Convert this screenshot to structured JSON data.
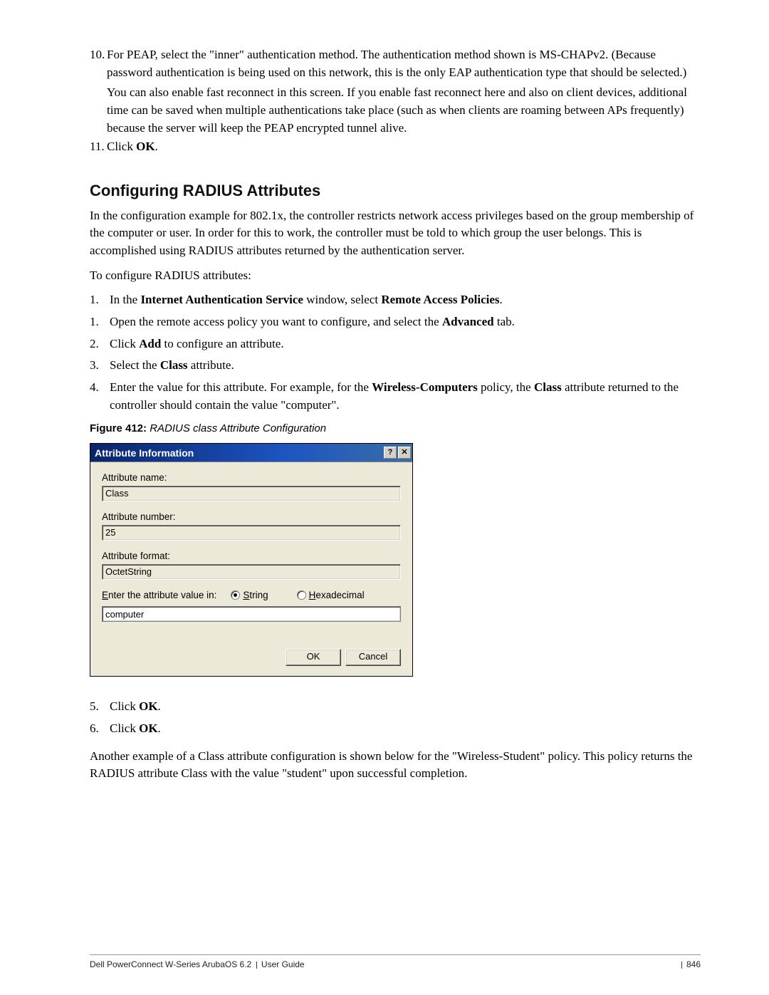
{
  "step10": {
    "num": "10.",
    "p1": "For PEAP, select the \"inner\" authentication method. The authentication method shown is MS-CHAPv2. (Because password authentication is being used on this network, this is the only EAP authentication type that should be selected.)",
    "p2": "You can also enable fast reconnect in this screen. If you enable fast reconnect here and also on client devices, additional time can be saved when multiple authentications take place (such as when clients are roaming between APs frequently) because the server will keep the PEAP encrypted tunnel alive."
  },
  "step11": {
    "num": "11.",
    "prefix": "Click ",
    "bold": "OK",
    "suffix": "."
  },
  "heading": "Configuring RADIUS Attributes",
  "intro": "In the configuration example for 802.1x, the controller restricts network access privileges based on the group membership of the computer or user. In order for this to work, the controller must be told to which group the user belongs. This is accomplished using RADIUS attributes returned by the authentication server.",
  "lead": "To configure RADIUS attributes:",
  "config": {
    "i1": {
      "n": "1.",
      "a": "In the ",
      "b": "Internet Authentication Service",
      "c": " window, select ",
      "d": "Remote Access Policies",
      "e": "."
    },
    "i2": {
      "n": "1.",
      "a": "Open the remote access policy you want to configure, and select the ",
      "b": "Advanced",
      "c": " tab."
    },
    "i3": {
      "n": "2.",
      "a": "Click ",
      "b": "Add",
      "c": " to configure an attribute."
    },
    "i4": {
      "n": "3.",
      "a": "Select the ",
      "b": "Class",
      "c": " attribute."
    },
    "i5": {
      "n": "4.",
      "a": "Enter the value for this attribute. For example, for the ",
      "b": "Wireless-Computers",
      "c": " policy, the ",
      "d": "Class",
      "e": " attribute returned to the controller should contain the value \"computer\"."
    }
  },
  "figure": {
    "label": "Figure 412:",
    "caption": " RADIUS class Attribute Configuration"
  },
  "dialog": {
    "title": "Attribute Information",
    "help_glyph": "?",
    "close_glyph": "✕",
    "attr_name_label": "Attribute name:",
    "attr_name_value": "Class",
    "attr_number_label": "Attribute number:",
    "attr_number_value": "25",
    "attr_format_label": "Attribute format:",
    "attr_format_value": "OctetString",
    "radio_prefix_label_E": "E",
    "radio_prefix_label_rest": "nter the attribute value in:",
    "radio_string_S": "S",
    "radio_string_rest": "tring",
    "radio_hex_H": "H",
    "radio_hex_rest": "exadecimal",
    "value_input": "computer",
    "ok": "OK",
    "cancel": "Cancel",
    "radio_selected": "string"
  },
  "followup": {
    "i5": {
      "n": "5.",
      "a": "Click ",
      "b": "OK",
      "c": "."
    },
    "i6": {
      "n": "6.",
      "a": "Click ",
      "b": "OK",
      "c": "."
    }
  },
  "outro": "Another example of a Class attribute configuration is shown below for the \"Wireless-Student\" policy. This policy returns the RADIUS attribute Class with the value \"student\" upon successful completion.",
  "footer": {
    "left": "Dell PowerConnect W-Series ArubaOS 6.2",
    "left2": "User Guide",
    "right_page": "846"
  }
}
